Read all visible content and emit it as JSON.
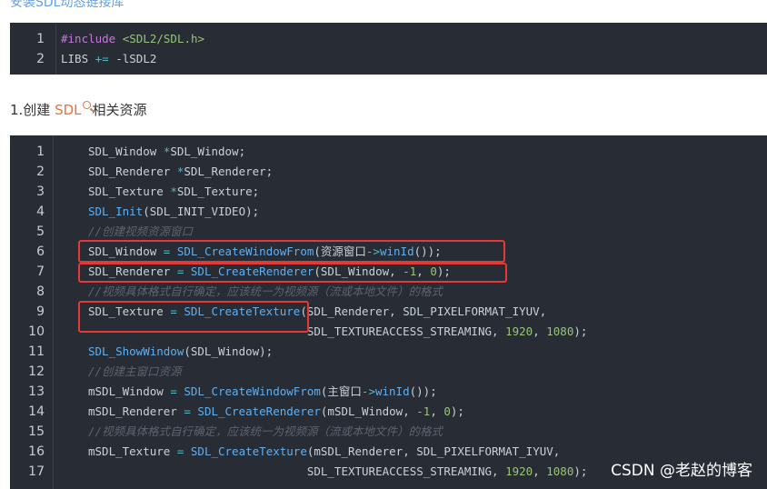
{
  "top_link": "安装SDL动态链接库",
  "block1": {
    "lines": [
      {
        "num": "1",
        "tokens": [
          {
            "t": "#include ",
            "c": "kw"
          },
          {
            "t": "<SDL2/SDL.h>",
            "c": "str"
          }
        ]
      },
      {
        "num": "2",
        "tokens": [
          {
            "t": "LIBS ",
            "c": ""
          },
          {
            "t": "+=",
            "c": "op"
          },
          {
            "t": " -lSDL2",
            "c": ""
          }
        ]
      }
    ]
  },
  "heading": {
    "prefix": "1.创建 ",
    "sdl": "SDL",
    "suffix": "相关资源"
  },
  "block2": {
    "lines": [
      {
        "num": "1",
        "tokens": [
          {
            "t": "SDL_Window ",
            "c": ""
          },
          {
            "t": "*",
            "c": "op"
          },
          {
            "t": "SDL_Window;",
            "c": ""
          }
        ]
      },
      {
        "num": "2",
        "tokens": [
          {
            "t": "SDL_Renderer ",
            "c": ""
          },
          {
            "t": "*",
            "c": "op"
          },
          {
            "t": "SDL_Renderer;",
            "c": ""
          }
        ]
      },
      {
        "num": "3",
        "tokens": [
          {
            "t": "SDL_Texture ",
            "c": ""
          },
          {
            "t": "*",
            "c": "op"
          },
          {
            "t": "SDL_Texture;",
            "c": ""
          }
        ]
      },
      {
        "num": "4",
        "tokens": [
          {
            "t": "SDL_Init",
            "c": "fn"
          },
          {
            "t": "(SDL_INIT_VIDEO);",
            "c": ""
          }
        ]
      },
      {
        "num": "5",
        "tokens": [
          {
            "t": "//创建视频资源窗口",
            "c": "cm"
          }
        ]
      },
      {
        "num": "6",
        "tokens": [
          {
            "t": "SDL_Window ",
            "c": ""
          },
          {
            "t": "=",
            "c": "op"
          },
          {
            "t": " ",
            "c": ""
          },
          {
            "t": "SDL_CreateWindowFrom",
            "c": "fn"
          },
          {
            "t": "(资源窗口",
            "c": ""
          },
          {
            "t": "->",
            "c": "op"
          },
          {
            "t": "winId",
            "c": "fn"
          },
          {
            "t": "());",
            "c": ""
          }
        ]
      },
      {
        "num": "7",
        "tokens": [
          {
            "t": "SDL_Renderer ",
            "c": ""
          },
          {
            "t": "=",
            "c": "op"
          },
          {
            "t": " ",
            "c": ""
          },
          {
            "t": "SDL_CreateRenderer",
            "c": "fn"
          },
          {
            "t": "(SDL_Window, ",
            "c": ""
          },
          {
            "t": "-1",
            "c": "num"
          },
          {
            "t": ", ",
            "c": ""
          },
          {
            "t": "0",
            "c": "num"
          },
          {
            "t": ");",
            "c": ""
          }
        ]
      },
      {
        "num": "8",
        "tokens": [
          {
            "t": "//视频具体格式自行确定，应该统一为视频源（流或本地文件）的格式",
            "c": "cm"
          }
        ]
      },
      {
        "num": "9",
        "tokens": [
          {
            "t": "SDL_Texture ",
            "c": ""
          },
          {
            "t": "=",
            "c": "op"
          },
          {
            "t": " ",
            "c": ""
          },
          {
            "t": "SDL_CreateTexture",
            "c": "fn"
          },
          {
            "t": "(SDL_Renderer, SDL_PIXELFORMAT_IYUV,",
            "c": ""
          }
        ]
      },
      {
        "num": "10",
        "tokens": [
          {
            "t": "                                SDL_TEXTUREACCESS_STREAMING, ",
            "c": ""
          },
          {
            "t": "1920",
            "c": "num"
          },
          {
            "t": ", ",
            "c": ""
          },
          {
            "t": "1080",
            "c": "num"
          },
          {
            "t": ");",
            "c": ""
          }
        ]
      },
      {
        "num": "11",
        "tokens": [
          {
            "t": "SDL_ShowWindow",
            "c": "fn"
          },
          {
            "t": "(SDL_Window);",
            "c": ""
          }
        ]
      },
      {
        "num": "12",
        "tokens": [
          {
            "t": "//创建主窗口资源",
            "c": "cm"
          }
        ]
      },
      {
        "num": "13",
        "tokens": [
          {
            "t": "mSDL_Window ",
            "c": ""
          },
          {
            "t": "=",
            "c": "op"
          },
          {
            "t": " ",
            "c": ""
          },
          {
            "t": "SDL_CreateWindowFrom",
            "c": "fn"
          },
          {
            "t": "(主窗口",
            "c": ""
          },
          {
            "t": "->",
            "c": "op"
          },
          {
            "t": "winId",
            "c": "fn"
          },
          {
            "t": "());",
            "c": ""
          }
        ]
      },
      {
        "num": "14",
        "tokens": [
          {
            "t": "mSDL_Renderer ",
            "c": ""
          },
          {
            "t": "=",
            "c": "op"
          },
          {
            "t": " ",
            "c": ""
          },
          {
            "t": "SDL_CreateRenderer",
            "c": "fn"
          },
          {
            "t": "(mSDL_Window, ",
            "c": ""
          },
          {
            "t": "-1",
            "c": "num"
          },
          {
            "t": ", ",
            "c": ""
          },
          {
            "t": "0",
            "c": "num"
          },
          {
            "t": ");",
            "c": ""
          }
        ]
      },
      {
        "num": "15",
        "tokens": [
          {
            "t": "//视频具体格式自行确定，应该统一为视频源（流或本地文件）的格式",
            "c": "cm"
          }
        ]
      },
      {
        "num": "16",
        "tokens": [
          {
            "t": "mSDL_Texture ",
            "c": ""
          },
          {
            "t": "=",
            "c": "op"
          },
          {
            "t": " ",
            "c": ""
          },
          {
            "t": "SDL_CreateTexture",
            "c": "fn"
          },
          {
            "t": "(mSDL_Renderer, SDL_PIXELFORMAT_IYUV,",
            "c": ""
          }
        ]
      },
      {
        "num": "17",
        "tokens": [
          {
            "t": "                                SDL_TEXTUREACCESS_STREAMING, ",
            "c": ""
          },
          {
            "t": "1920",
            "c": "num"
          },
          {
            "t": ", ",
            "c": ""
          },
          {
            "t": "1080",
            "c": "num"
          },
          {
            "t": ");",
            "c": ""
          }
        ]
      }
    ]
  },
  "watermark": "CSDN @老赵的博客",
  "colors": {
    "code_bg": "#282c34",
    "highlight": "#e53935",
    "accent": "#e8733a"
  }
}
